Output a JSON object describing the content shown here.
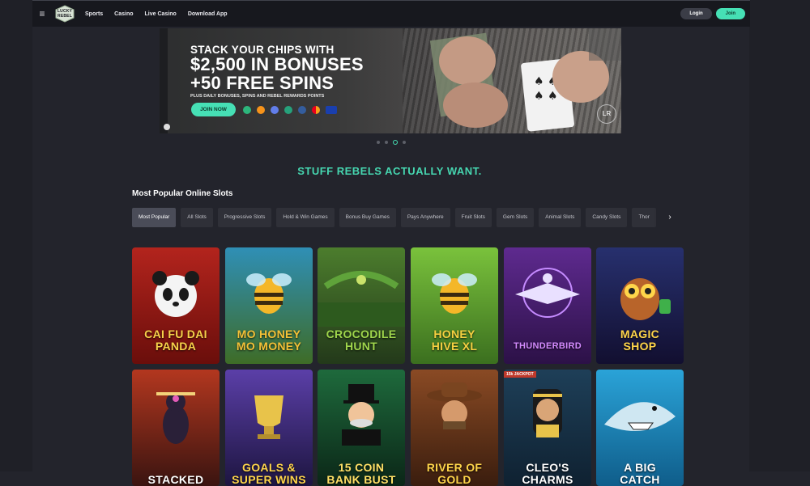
{
  "header": {
    "menu_icon": "≡",
    "logo_text": [
      "LUCKY",
      "REBEL"
    ],
    "nav": [
      "Sports",
      "Casino",
      "Live Casino",
      "Download App"
    ],
    "login_label": "Login",
    "join_label": "Join"
  },
  "banner": {
    "headline_1": "STACK YOUR CHIPS WITH",
    "headline_2": "$2,500 IN BONUSES",
    "headline_3": "+50 FREE SPINS",
    "subline": "PLUS DAILY BONUSES, SPINS AND REBEL REWARDS POINTS",
    "cta": "JOIN NOW",
    "payment_icons": [
      "bitcoin-cash-icon",
      "bitcoin-icon",
      "ethereum-icon",
      "tether-icon",
      "litecoin-icon",
      "mastercard-icon",
      "visa-icon"
    ],
    "badge": "LR"
  },
  "carousel": {
    "count": 4,
    "active_index": 2
  },
  "tagline": "STUFF REBELS ACTUALLY WANT.",
  "section_title": "Most Popular Online Slots",
  "categories": [
    "Most Popular",
    "All Slots",
    "Progressive Slots",
    "Hold & Win Games",
    "Bonus Buy Games",
    "Pays Anywhere",
    "Fruit Slots",
    "Gem Slots",
    "Animal Slots",
    "Candy Slots",
    "Thor"
  ],
  "active_category": "Most Popular",
  "games": [
    {
      "title": "CAI FU DAI PANDA",
      "lines": [
        "CAI FU DAI",
        "PANDA"
      ],
      "bg": "#b3241d",
      "bg2": "#6a0e0b",
      "text_color": "#f7d24a",
      "icon": "panda-icon",
      "badge": ""
    },
    {
      "title": "MO HONEY MO MONEY",
      "lines": [
        "MO HONEY",
        "MO MONEY"
      ],
      "bg": "#2f8fb6",
      "bg2": "#3e6c27",
      "text_color": "#f4c137",
      "icon": "bee-icon",
      "badge": ""
    },
    {
      "title": "CROCODILE HUNT",
      "lines": [
        "CROCODILE",
        "HUNT"
      ],
      "bg": "#4c7d2d",
      "bg2": "#23391a",
      "text_color": "#9fd64c",
      "icon": "crocodile-icon",
      "badge": ""
    },
    {
      "title": "HONEY HIVE XL",
      "lines": [
        "HONEY",
        "HIVE XL"
      ],
      "bg": "#7ac23c",
      "bg2": "#3b6f1f",
      "text_color": "#f6d041",
      "icon": "bee-icon",
      "badge": ""
    },
    {
      "title": "THUNDERBIRD",
      "lines": [
        "THUNDERBIRD"
      ],
      "bg": "#5e2a8f",
      "bg2": "#2c1147",
      "text_color": "#d48bff",
      "icon": "thunderbird-icon",
      "badge": ""
    },
    {
      "title": "MAGIC SHOP",
      "lines": [
        "MAGIC",
        "SHOP"
      ],
      "bg": "#27306e",
      "bg2": "#120f30",
      "text_color": "#ffd54a",
      "icon": "owl-icon",
      "badge": ""
    },
    {
      "title": "STACKED",
      "lines": [
        "STACKED"
      ],
      "bg": "#b3371f",
      "bg2": "#3a1410",
      "text_color": "#ffffff",
      "icon": "cat-icon",
      "badge": ""
    },
    {
      "title": "GOALS & SUPER WINS",
      "lines": [
        "GOALS &",
        "SUPER WINS"
      ],
      "bg": "#5b3fa8",
      "bg2": "#1d1540",
      "text_color": "#ffd54a",
      "icon": "trophy-icon",
      "badge": ""
    },
    {
      "title": "15 COIN BANK BUST",
      "lines": [
        "15 COIN",
        "BANK BUST"
      ],
      "bg": "#1e6a3c",
      "bg2": "#0b2617",
      "text_color": "#ffe066",
      "icon": "banker-icon",
      "badge": ""
    },
    {
      "title": "RIVER OF GOLD",
      "lines": [
        "RIVER OF",
        "GOLD"
      ],
      "bg": "#8a4a24",
      "bg2": "#3a1d0e",
      "text_color": "#ffd54a",
      "icon": "cowboy-icon",
      "badge": ""
    },
    {
      "title": "CLEO'S CHARMS",
      "lines": [
        "CLEO'S",
        "CHARMS"
      ],
      "bg": "#1e3f58",
      "bg2": "#0f2131",
      "text_color": "#ffffff",
      "icon": "cleopatra-icon",
      "badge": "15k JACKPOT"
    },
    {
      "title": "A BIG CATCH",
      "lines": [
        "A BIG",
        "CATCH"
      ],
      "bg": "#2aa3d8",
      "bg2": "#0f5d8a",
      "text_color": "#ffffff",
      "icon": "shark-icon",
      "badge": ""
    }
  ]
}
